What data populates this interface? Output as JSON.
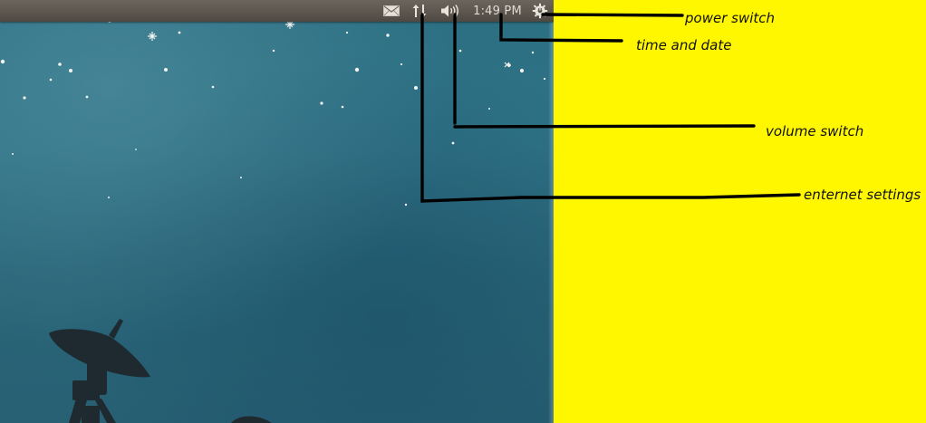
{
  "panel": {
    "indicators": [
      {
        "name": "mail",
        "icon": "envelope-icon"
      },
      {
        "name": "network",
        "icon": "network-arrows-icon"
      },
      {
        "name": "volume",
        "icon": "speaker-icon"
      },
      {
        "name": "power",
        "icon": "power-gear-icon"
      }
    ],
    "clock": "1:49 PM"
  },
  "annotations": {
    "power": "power switch",
    "time": "time and date",
    "volume": "volume switch",
    "internet": "enternet settings"
  },
  "colors": {
    "annotation_background": "#fff700",
    "panel": "#5d564f",
    "wallpaper": "#2c6f82",
    "annotation_lines": "#000000",
    "panel_text": "#dfdbd2"
  }
}
